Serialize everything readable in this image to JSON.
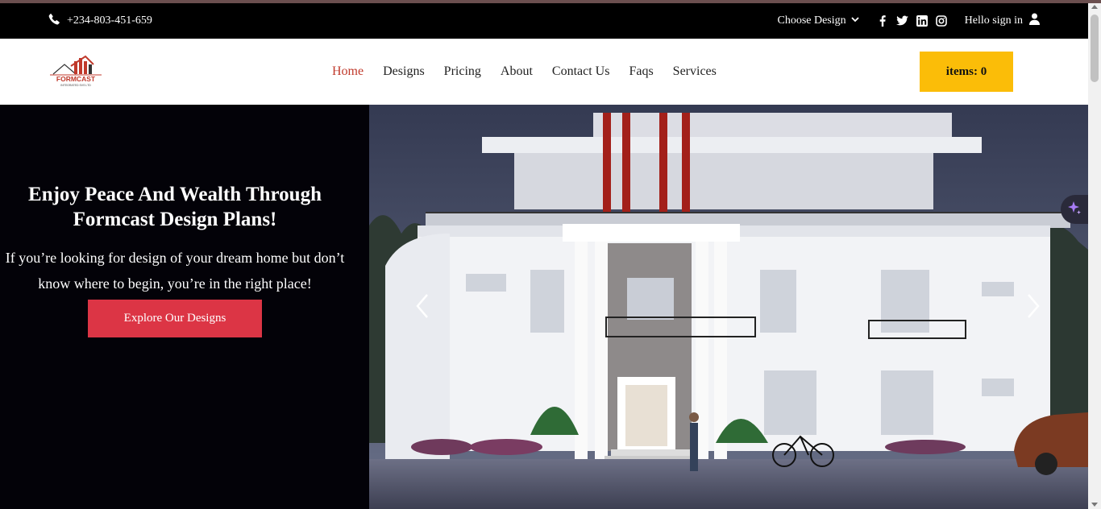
{
  "topbar": {
    "phone": "+234-803-451-659",
    "choose_design": "Choose Design",
    "social_icons": [
      "facebook-icon",
      "twitter-icon",
      "linkedin-icon",
      "instagram-icon"
    ],
    "signin": "Hello sign in"
  },
  "header": {
    "logo_text": "FORMCAST",
    "logo_subtext": "INTEGRATED SVS LTD",
    "nav": [
      {
        "label": "Home",
        "active": true
      },
      {
        "label": "Designs",
        "active": false
      },
      {
        "label": "Pricing",
        "active": false
      },
      {
        "label": "About",
        "active": false
      },
      {
        "label": "Contact Us",
        "active": false
      },
      {
        "label": "Faqs",
        "active": false
      },
      {
        "label": "Services",
        "active": false
      }
    ],
    "cart_label": "items: 0"
  },
  "hero": {
    "title": "Enjoy Peace And Wealth Through Formcast Design Plans!",
    "subtitle": "If you’re looking for design of your dream home but don’t know where to begin, you’re in the right place!",
    "button": "Explore Our Designs"
  },
  "colors": {
    "accent_red": "#dc3545",
    "active_nav": "#c0392b",
    "cart_yellow": "#fbbd08",
    "topbar_bg": "#000000",
    "hero_left_bg": "#030208"
  }
}
